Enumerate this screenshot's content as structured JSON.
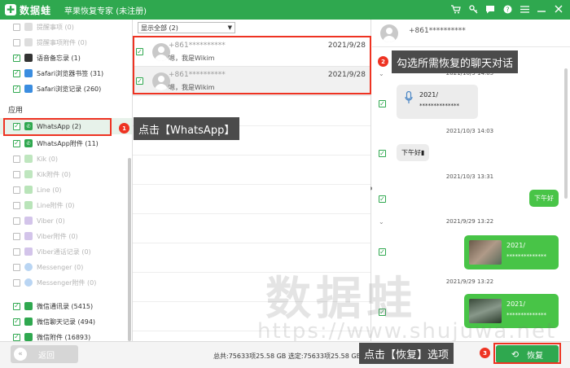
{
  "brand": {
    "logo_mark": "✚",
    "name": "数据蛙",
    "title": "苹果恢复专家 (未注册)"
  },
  "titlebar_icons": [
    "cart-icon",
    "key-icon",
    "message-icon",
    "question-icon",
    "menu-icon",
    "minimize-icon",
    "close-icon"
  ],
  "sidebar": {
    "items_top": [
      {
        "label": "提醒事项 (0)",
        "checked": false
      },
      {
        "label": "提醒事项附件 (0)",
        "checked": false
      },
      {
        "label": "语音备忘录 (1)",
        "checked": true
      },
      {
        "label": "Safari浏览器书签 (31)",
        "checked": true
      },
      {
        "label": "Safari浏览记录 (260)",
        "checked": true
      }
    ],
    "section_title": "应用",
    "items_apps": [
      {
        "label": "WhatsApp (2)",
        "checked": true
      },
      {
        "label": "WhatsApp附件 (11)",
        "checked": true
      },
      {
        "label": "Kik (0)",
        "checked": false
      },
      {
        "label": "Kik附件 (0)",
        "checked": false
      },
      {
        "label": "Line (0)",
        "checked": false
      },
      {
        "label": "Line附件 (0)",
        "checked": false
      },
      {
        "label": "Viber (0)",
        "checked": false
      },
      {
        "label": "Viber附件 (0)",
        "checked": false
      },
      {
        "label": "Viber通话记录 (0)",
        "checked": false
      },
      {
        "label": "Messenger (0)",
        "checked": false
      },
      {
        "label": "Messenger附件 (0)",
        "checked": false
      },
      {
        "label": "微信通讯录 (5415)",
        "checked": true
      },
      {
        "label": "微信聊天记录 (494)",
        "checked": true
      },
      {
        "label": "微信附件 (16893)",
        "checked": true
      }
    ]
  },
  "list": {
    "filter_label": "显示全部 (2)",
    "rows": [
      {
        "name": "+861**********",
        "preview": "嗯，我是Wikim",
        "date": "2021/9/28"
      },
      {
        "name": "+861**********",
        "preview": "嗯，我是Wikim",
        "date": "2021/9/28"
      }
    ]
  },
  "chat": {
    "contact": "+861**********",
    "messages": [
      {
        "time": "2021/10/3 14:05"
      },
      {
        "dir": "in",
        "voice": true,
        "line1": "2021/",
        "line2": "**************"
      },
      {
        "time": "2021/10/3 14:03"
      },
      {
        "dir": "in",
        "text": "下午好▮"
      },
      {
        "time": "2021/10/3 13:31"
      },
      {
        "dir": "out",
        "text": "下午好"
      },
      {
        "time": "2021/9/29 13:22"
      },
      {
        "dir": "out",
        "image": true,
        "line1": "2021/",
        "line2": "**************"
      },
      {
        "time": "2021/9/29 13:22"
      },
      {
        "dir": "out",
        "image": true,
        "line1": "2021/",
        "line2": "**************"
      }
    ]
  },
  "bottom": {
    "back_label": "返回",
    "totals": "总共:75633项25.58 GB 选定:75633项25.58 GB",
    "recover_label": "恢复"
  },
  "annotations": [
    {
      "num": "1",
      "text": "点击【WhatsApp】"
    },
    {
      "num": "2",
      "text": "勾选所需恢复的聊天对话"
    },
    {
      "num": "3",
      "text": "点击【恢复】选项"
    }
  ],
  "watermark": {
    "line1": "数据蛙",
    "line2": "https://www.shujuwa.net"
  },
  "colors": {
    "accent": "#2fa84f",
    "highlight": "#e33322",
    "bubble_out": "#48c447"
  }
}
